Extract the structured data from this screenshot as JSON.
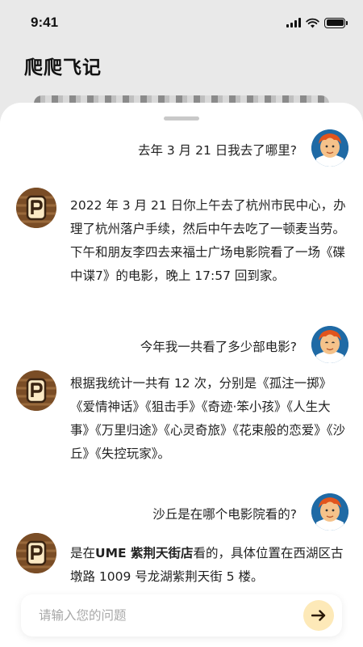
{
  "status_bar": {
    "time": "9:41"
  },
  "app": {
    "title": "爬爬飞记"
  },
  "chat": {
    "messages": [
      {
        "role": "user",
        "text": "去年 3 月 21 日我去了哪里?"
      },
      {
        "role": "assistant",
        "text": "2022 年 3 月 21 日你上午去了杭州市民中心，办理了杭州落户手续，然后中午去吃了一顿麦当劳。下午和朋友李四去来福士广场电影院看了一场《碟中谍7》的电影，晚上 17:57 回到家。"
      },
      {
        "role": "user",
        "text": "今年我一共看了多少部电影?"
      },
      {
        "role": "assistant",
        "text": "根据我统计一共有 12 次，分别是《孤注一掷》《爱情神话》《狙击手》《奇迹·笨小孩》《人生大事》《万里归途》《心灵奇旅》《花束般的恋爱》《沙丘》《失控玩家》。"
      },
      {
        "role": "user",
        "text": "沙丘是在哪个电影院看的?"
      },
      {
        "role": "assistant",
        "prefix": "是在",
        "highlight": "UME 紫荆天街店",
        "suffix": "看的，具体位置在西湖区古墩路 1009 号龙湖紫荆天街 5 楼。"
      }
    ]
  },
  "input": {
    "placeholder": "请输入您的问题",
    "value": ""
  },
  "colors": {
    "accent_send_bg": "#fde9b8",
    "bot_avatar": "#7a4d26",
    "user_avatar": "#1f6aa5"
  },
  "icons": {
    "send": "arrow-right-icon",
    "bot_avatar": "p-logo-icon",
    "user_avatar": "cartoon-face-icon"
  }
}
